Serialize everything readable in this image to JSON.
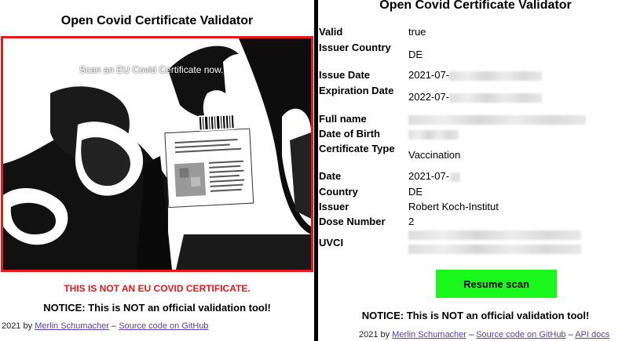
{
  "left": {
    "title": "Open Covid Certificate Validator",
    "scan_prompt": "Scan an EU Covid Certificate now.",
    "error": "THIS IS NOT AN EU COVID CERTIFICATE.",
    "notice": "NOTICE: This is NOT an official validation tool!",
    "footer": {
      "prefix": "2021 by ",
      "author": "Merlin Schumacher",
      "sep": " – ",
      "source": "Source code on GitHub"
    }
  },
  "right": {
    "title": "Open Covid Certificate Validator",
    "fields": [
      {
        "key": "Valid",
        "value": "true"
      },
      {
        "key": "Issuer Country",
        "value": "DE"
      },
      {
        "key": "Issue Date",
        "value": "2021-07-"
      },
      {
        "key": "Expiration Date",
        "value": "2022-07-"
      },
      {
        "key": "Full name",
        "value": ""
      },
      {
        "key": "Date of Birth",
        "value": ""
      },
      {
        "key": "Certificate Type",
        "value": "Vaccination"
      },
      {
        "key": "Date",
        "value": "2021-07-"
      },
      {
        "key": "Country",
        "value": "DE"
      },
      {
        "key": "Issuer",
        "value": "Robert Koch-Institut"
      },
      {
        "key": "Dose Number",
        "value": "2"
      },
      {
        "key": "UVCI",
        "value": ""
      }
    ],
    "resume_button": "Resume scan",
    "notice": "NOTICE: This is NOT an official validation tool!",
    "footer": {
      "prefix": "2021 by ",
      "author": "Merlin Schumacher",
      "sep1": " – ",
      "source": "Source code on GitHub",
      "sep2": " – ",
      "api": "API docs"
    }
  },
  "colors": {
    "accent_red": "#e8181c",
    "button_green": "#1bf81b",
    "link": "#5b3fa4"
  }
}
